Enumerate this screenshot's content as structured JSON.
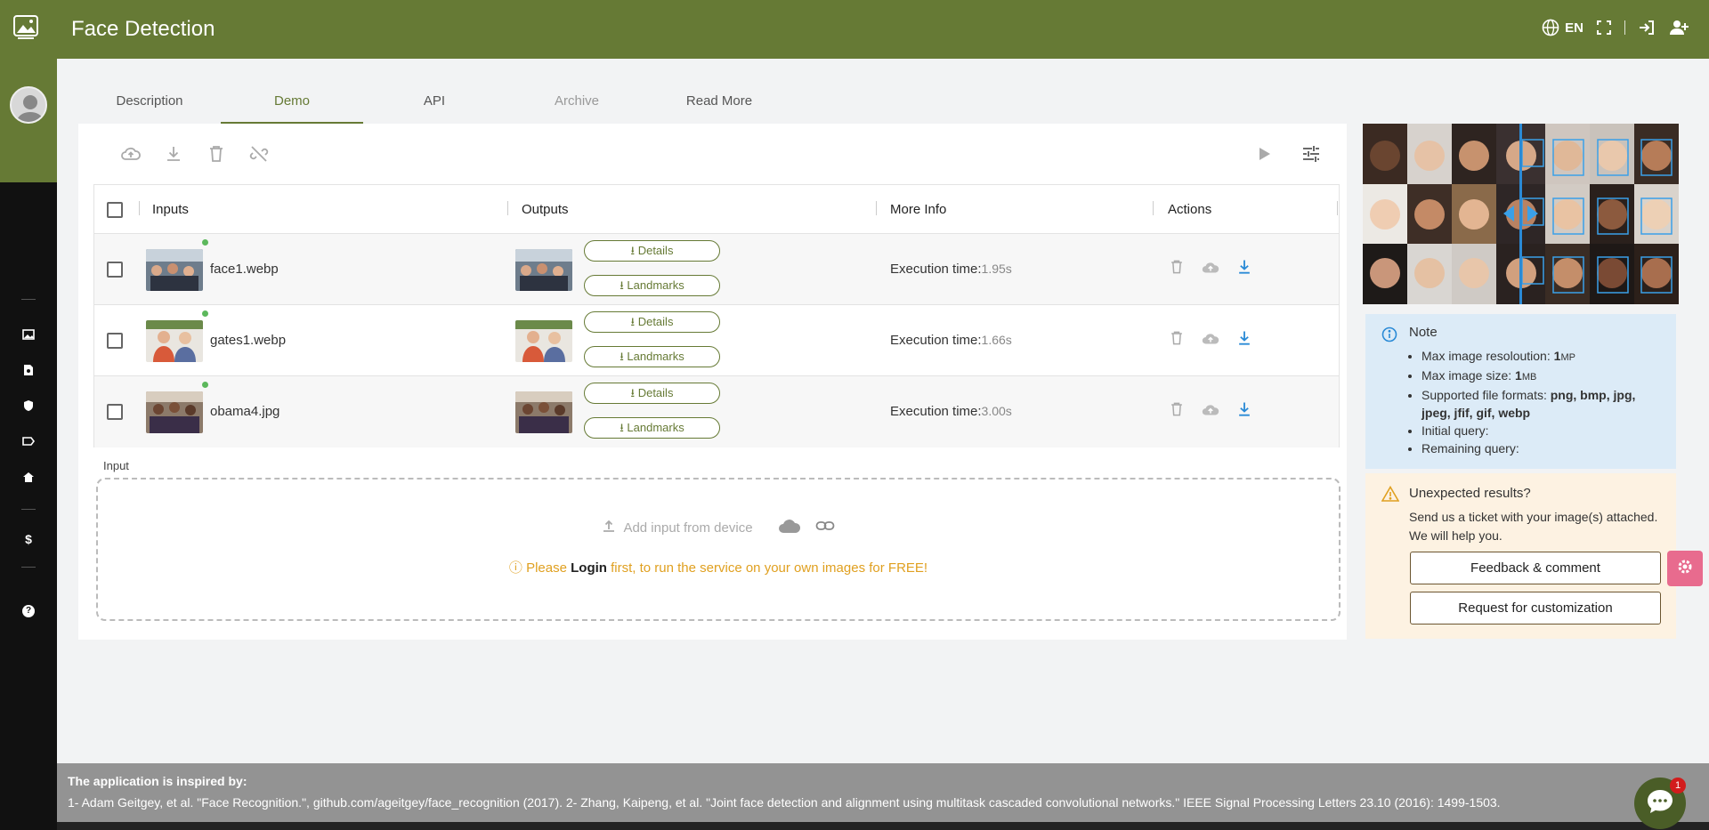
{
  "app": {
    "title": "Face Detection",
    "language": "EN"
  },
  "colors": {
    "brand": "#667a35",
    "accent_blue": "#2a8ad6",
    "note_bg": "#dcebf7",
    "warn_bg": "#fdf2e2"
  },
  "tabs": [
    {
      "label": "Description",
      "state": "normal"
    },
    {
      "label": "Demo",
      "state": "active"
    },
    {
      "label": "API",
      "state": "normal"
    },
    {
      "label": "Archive",
      "state": "disabled"
    },
    {
      "label": "Read More",
      "state": "normal"
    }
  ],
  "table": {
    "headers": {
      "inputs": "Inputs",
      "outputs": "Outputs",
      "more_info": "More Info",
      "actions": "Actions"
    },
    "details_label": "Details",
    "landmarks_label": "Landmarks",
    "exec_label": "Execution time:",
    "rows": [
      {
        "file": "face1.webp",
        "exec_time": "1.95s"
      },
      {
        "file": "gates1.webp",
        "exec_time": "1.66s"
      },
      {
        "file": "obama4.jpg",
        "exec_time": "3.00s"
      }
    ]
  },
  "input": {
    "label": "Input",
    "add_from_device": "Add input from device",
    "login_prefix": "Please ",
    "login_link": "Login",
    "login_suffix": " first, to run the service on your own images for FREE!"
  },
  "note": {
    "title": "Note",
    "items": [
      {
        "label": "Max image resoloution: ",
        "value": "1",
        "unit": "MP"
      },
      {
        "label": "Max image size: ",
        "value": "1",
        "unit": "MB"
      },
      {
        "label": "Supported file formats: ",
        "value": "png, bmp, jpg, jpeg, jfif, gif, webp",
        "unit": ""
      },
      {
        "label": "Initial query:",
        "value": "",
        "unit": ""
      },
      {
        "label": "Remaining query:",
        "value": "",
        "unit": ""
      }
    ]
  },
  "unexpected": {
    "title": "Unexpected results?",
    "text": "Send us a ticket with your image(s) attached. We will help you.",
    "feedback_button": "Feedback & comment",
    "customization_button": "Request for customization"
  },
  "footer": {
    "heading": "The application is inspired by:",
    "text": "1- Adam Geitgey, et al. \"Face Recognition.\", github.com/ageitgey/face_recognition (2017). 2- Zhang, Kaipeng, et al. \"Joint face detection and alignment using multitask cascaded convolutional networks.\" IEEE Signal Processing Letters 23.10 (2016): 1499-1503."
  },
  "chat": {
    "badge": "1"
  },
  "sidebar": {
    "dollar": "$",
    "help": "?"
  }
}
